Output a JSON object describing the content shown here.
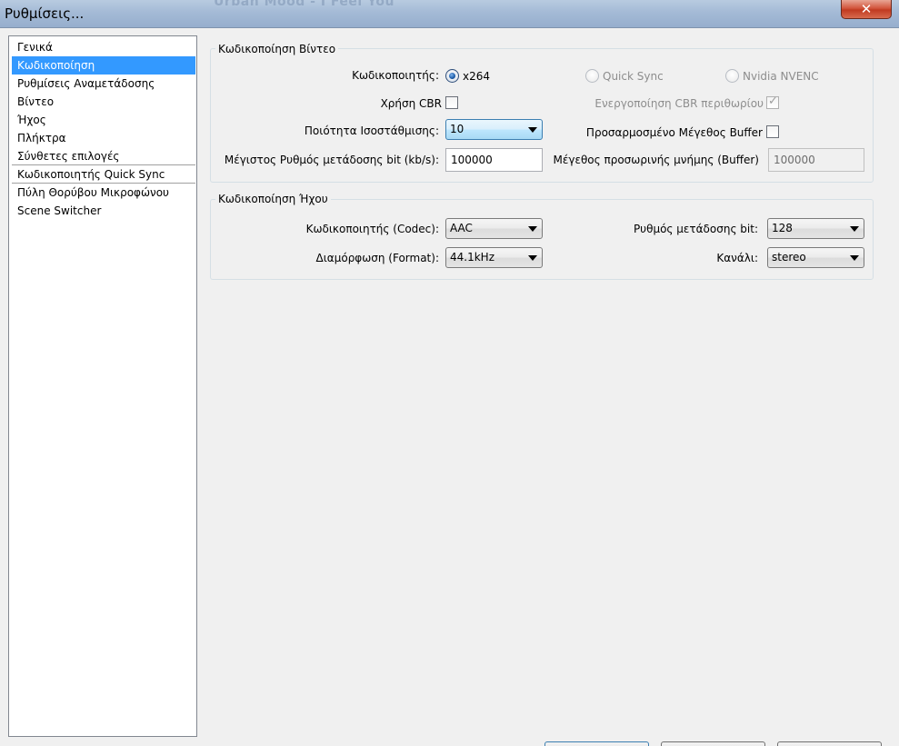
{
  "window": {
    "title": "Ρυθμίσεις...",
    "background_title": "Urban Mood - I Feel You",
    "close_glyph": "✕"
  },
  "sidebar": {
    "items": [
      {
        "label": "Γενικά"
      },
      {
        "label": "Κωδικοποίηση",
        "selected": true
      },
      {
        "label": "Ρυθμίσεις Αναμετάδοσης"
      },
      {
        "label": "Βίντεο"
      },
      {
        "label": "Ήχος"
      },
      {
        "label": "Πλήκτρα"
      },
      {
        "label": "Σύνθετες επιλογές"
      },
      {
        "label": "Κωδικοποιητής Quick Sync"
      },
      {
        "label": "Πύλη Θορύβου Μικροφώνου"
      },
      {
        "label": "Scene Switcher"
      }
    ]
  },
  "video": {
    "group_title": "Κωδικοποίηση Βίντεο",
    "encoder_label": "Κωδικοποιητής:",
    "encoders": [
      "x264",
      "Quick Sync",
      "Nvidia NVENC"
    ],
    "selected_encoder": "x264",
    "cbr_label": "Χρήση CBR",
    "cbr_checked": false,
    "cbr_padding_label": "Ενεργοποίηση CBR περιθωρίου",
    "cbr_padding_checked": true,
    "quality_label": "Ποιότητα Ισοστάθμισης:",
    "quality_value": "10",
    "custom_buffer_label": "Προσαρμοσμένο Μέγεθος Buffer",
    "custom_buffer_checked": false,
    "max_bitrate_label": "Μέγιστος Ρυθμός μετάδοσης bit (kb/s):",
    "max_bitrate_value": "100000",
    "buffer_size_label": "Μέγεθος προσωρινής μνήμης (Buffer)",
    "buffer_size_value": "100000"
  },
  "audio": {
    "group_title": "Κωδικοποίηση Ήχου",
    "codec_label": "Κωδικοποιητής (Codec):",
    "codec_value": "AAC",
    "bitrate_label": "Ρυθμός μετάδοσης bit:",
    "bitrate_value": "128",
    "format_label": "Διαμόρφωση (Format):",
    "format_value": "44.1kHz",
    "channel_label": "Κανάλι:",
    "channel_value": "stereo"
  },
  "icons": {
    "close": "close-icon",
    "checkmark": "checkmark-icon",
    "dropdown": "chevron-down-icon"
  }
}
